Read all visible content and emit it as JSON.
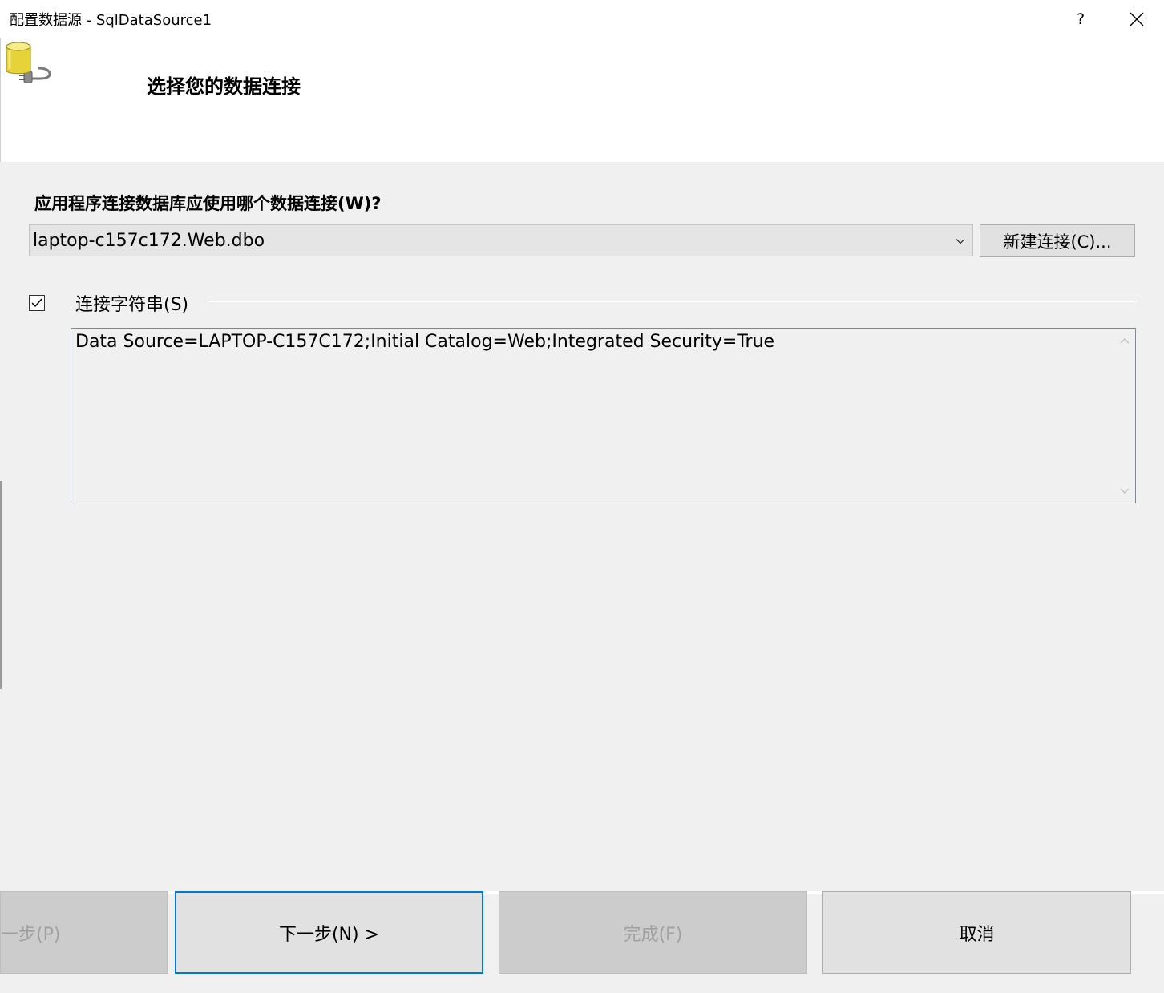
{
  "window": {
    "title": "配置数据源 - SqlDataSource1",
    "help_label": "?"
  },
  "wizard": {
    "heading": "选择您的数据连接",
    "question": "应用程序连接数据库应使用哪个数据连接(W)?",
    "connection": {
      "selected": "laptop-c157c172.Web.dbo",
      "new_button": "新建连接(C)..."
    },
    "connection_string": {
      "checked": true,
      "label": "连接字符串(S)",
      "value": "Data Source=LAPTOP-C157C172;Initial Catalog=Web;Integrated Security=True"
    }
  },
  "footer": {
    "prev_label": "一步(P)",
    "next_label": "下一步(N) >",
    "finish_label": "完成(F)",
    "cancel_label": "取消"
  },
  "icons": {
    "database": "database-plug-icon",
    "close": "close-icon",
    "dropdown": "chevron-down-icon",
    "check": "check-icon"
  },
  "colors": {
    "accent": "#0078d7",
    "dialog_bg": "#f0f0f0",
    "header_bg": "#ffffff",
    "disabled_text": "#a0a0a0"
  }
}
